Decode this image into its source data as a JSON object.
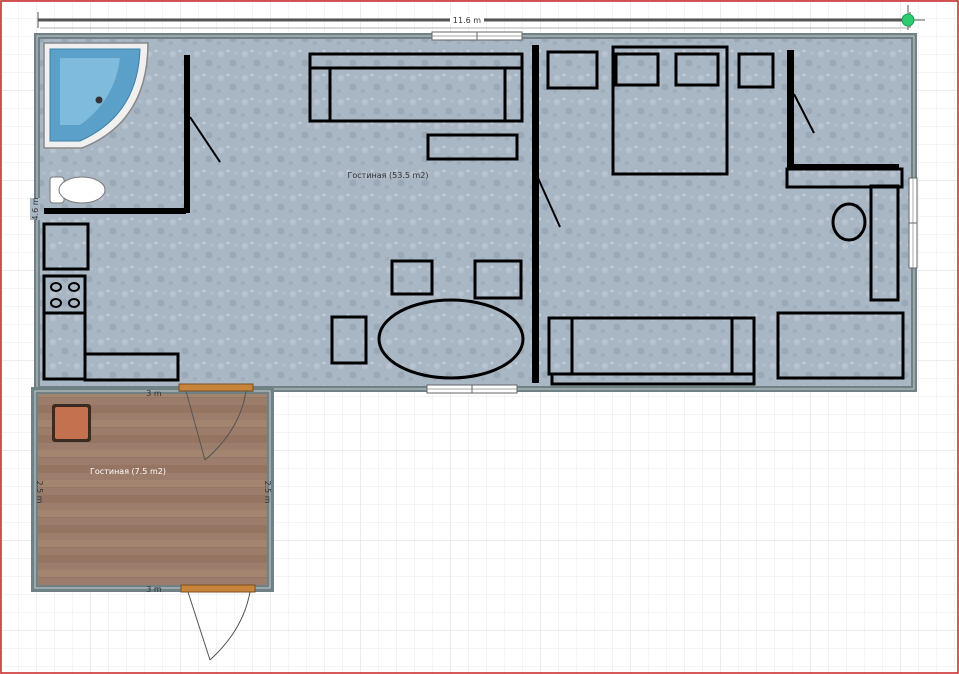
{
  "plan": {
    "rooms": [
      {
        "id": "main",
        "label": "Гостиная (53.5 m2)"
      },
      {
        "id": "annex",
        "label": "Гостиная (7.5 m2)"
      }
    ],
    "dimensions": {
      "total_width": "11.6 m",
      "main_height": "4.6 m",
      "annex_top_width": "3 m",
      "annex_bottom_width": "3 m",
      "annex_left_height": "2.5 m",
      "annex_right_height": "2.5 m"
    },
    "colors": {
      "floor_main": "#a9b6c4",
      "floor_wood": "#9c7d6b",
      "wall": "#6f8185",
      "furniture": "#000000",
      "door": "#c8843a",
      "grid": "#e3e3e3",
      "frame": "#cc2222",
      "handle": "#2ecc71"
    },
    "icons": [
      "bathtub-icon",
      "toilet-icon",
      "stove-icon"
    ]
  }
}
